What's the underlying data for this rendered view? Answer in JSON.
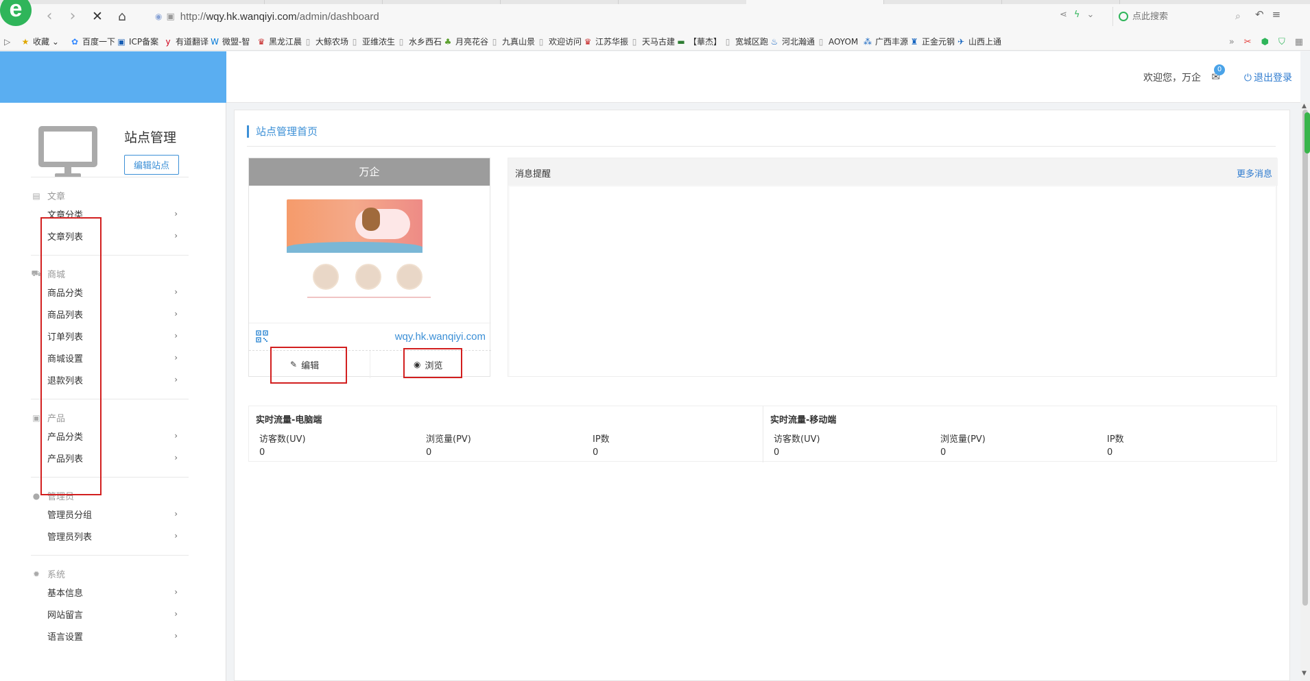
{
  "browser": {
    "url_prefix": "http://",
    "url_host": "wqy.hk.wanqiyi.com",
    "url_path": "/admin/dashboard",
    "search_placeholder": "点此搜索",
    "bookmarks": [
      {
        "icon": "star-icon",
        "label": "收藏 ⌄",
        "color": "#e0a800"
      },
      {
        "icon": "baidu-icon",
        "label": "百度一下",
        "color": "#3388ff"
      },
      {
        "icon": "icp-icon",
        "label": "ICP备案",
        "color": "#1a5fb4"
      },
      {
        "icon": "youdao-icon",
        "label": "有道翻译",
        "color": "#d0021b"
      },
      {
        "icon": "w-icon",
        "label": "微盟-智",
        "color": "#0078d7"
      },
      {
        "icon": "crown-icon",
        "label": "黑龙江晨",
        "color": "#c62828"
      },
      {
        "icon": "page-icon",
        "label": "大鲸农场",
        "color": "#999999"
      },
      {
        "icon": "page-icon",
        "label": "亚维浓生",
        "color": "#999999"
      },
      {
        "icon": "page-icon",
        "label": "水乡西石",
        "color": "#999999"
      },
      {
        "icon": "leaf-icon",
        "label": "月亮花谷",
        "color": "#5aa02c"
      },
      {
        "icon": "page-icon",
        "label": "九真山景",
        "color": "#999999"
      },
      {
        "icon": "page-icon",
        "label": "欢迎访问",
        "color": "#999999"
      },
      {
        "icon": "crown-icon",
        "label": "江苏华振",
        "color": "#c62828"
      },
      {
        "icon": "page-icon",
        "label": "天马古建",
        "color": "#999999"
      },
      {
        "icon": "huajie-icon",
        "label": "【華杰】",
        "color": "#2e7d32"
      },
      {
        "icon": "page-icon",
        "label": "宽城区跑",
        "color": "#999999"
      },
      {
        "icon": "hebei-icon",
        "label": "河北瀚通",
        "color": "#1565c0"
      },
      {
        "icon": "page-icon",
        "label": "AOYOM",
        "color": "#999999"
      },
      {
        "icon": "guangxi-icon",
        "label": "广西丰源",
        "color": "#1565c0"
      },
      {
        "icon": "zhengjin-icon",
        "label": "正金元钢",
        "color": "#1565c0"
      },
      {
        "icon": "shanxi-icon",
        "label": "山西上通",
        "color": "#1565c0"
      }
    ]
  },
  "header": {
    "welcome": "欢迎您，万企",
    "mail_count": "0",
    "logout": "退出登录"
  },
  "sidebar": {
    "site_title": "站点管理",
    "edit_site_button": "编辑站点",
    "sections": [
      {
        "title": "文章",
        "icon": "document-icon",
        "items": [
          "文章分类",
          "文章列表"
        ]
      },
      {
        "title": "商城",
        "icon": "cart-icon",
        "items": [
          "商品分类",
          "商品列表",
          "订单列表",
          "商城设置",
          "退款列表"
        ]
      },
      {
        "title": "产品",
        "icon": "box-icon",
        "items": [
          "产品分类",
          "产品列表"
        ]
      },
      {
        "title": "管理员",
        "icon": "user-icon",
        "items": [
          "管理员分组",
          "管理员列表"
        ]
      },
      {
        "title": "系统",
        "icon": "gear-icon",
        "items": [
          "基本信息",
          "网站留言",
          "语言设置"
        ]
      }
    ]
  },
  "main": {
    "page_heading": "站点管理首页",
    "site_card": {
      "name": "万企",
      "url": "wqy.hk.wanqiyi.com",
      "edit_button": "编辑",
      "preview_button": "浏览"
    },
    "messages": {
      "title": "消息提醒",
      "more_link": "更多消息"
    },
    "traffic": [
      {
        "title": "实时流量-电脑端",
        "metrics": [
          {
            "label": "访客数(UV)",
            "value": "0"
          },
          {
            "label": "浏览量(PV)",
            "value": "0"
          },
          {
            "label": "IP数",
            "value": "0"
          }
        ]
      },
      {
        "title": "实时流量-移动端",
        "metrics": [
          {
            "label": "访客数(UV)",
            "value": "0"
          },
          {
            "label": "浏览量(PV)",
            "value": "0"
          },
          {
            "label": "IP数",
            "value": "0"
          }
        ]
      }
    ]
  },
  "colors": {
    "brand_blue": "#5aaef1",
    "link_blue": "#2e7bcf",
    "highlight_red": "#d21e1e"
  }
}
